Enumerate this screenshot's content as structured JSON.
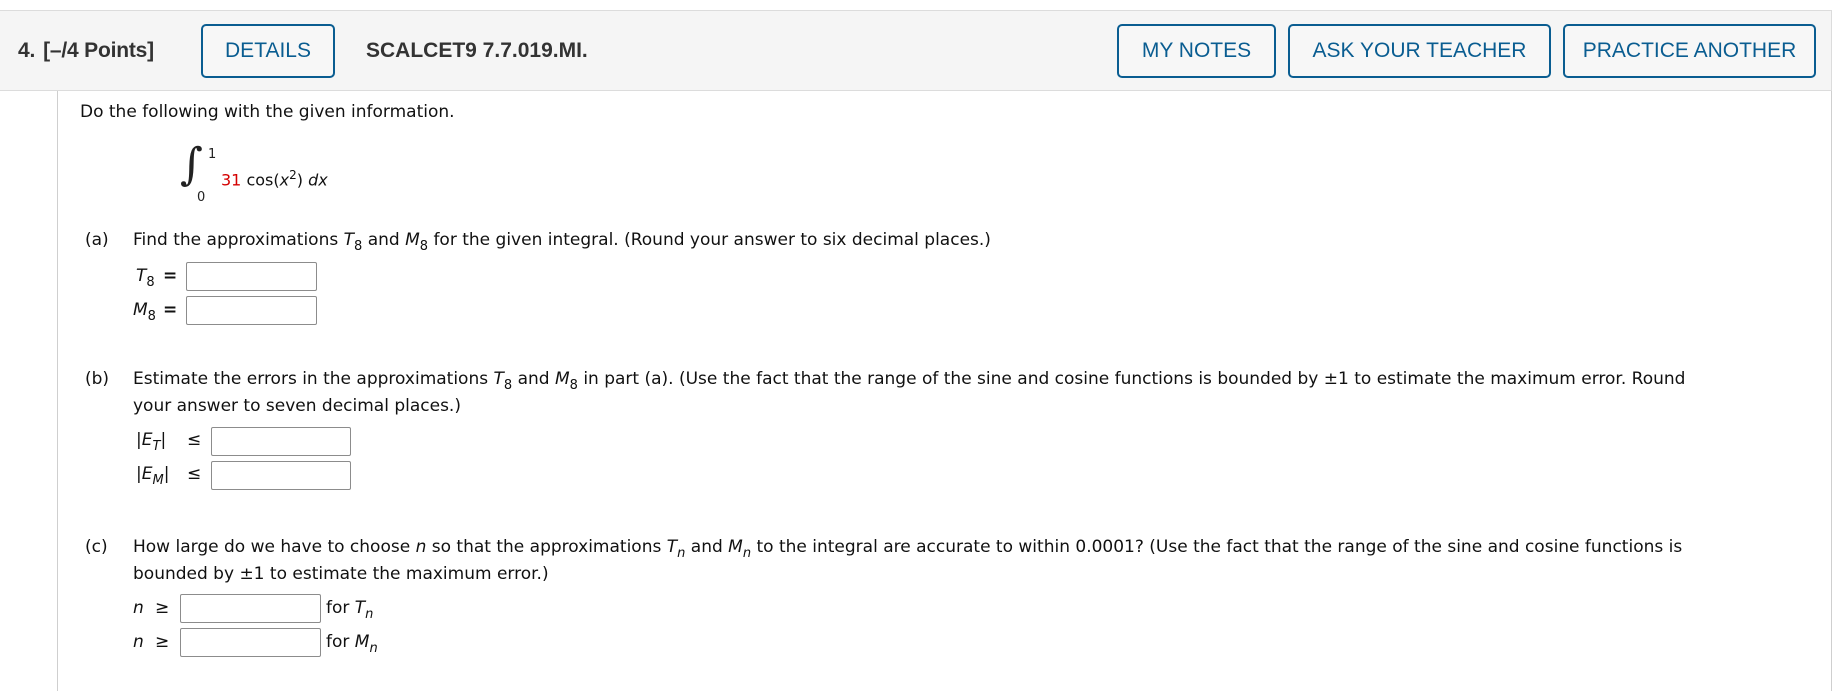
{
  "header": {
    "question_number": "4.",
    "points": "[–/4 Points]",
    "details_label": "DETAILS",
    "problem_code": "SCALCET9 7.7.019.MI.",
    "my_notes_label": "MY NOTES",
    "ask_teacher_label": "ASK YOUR TEACHER",
    "practice_another_label": "PRACTICE ANOTHER"
  },
  "colors": {
    "accent": "#0a5d91",
    "highlight_number": "#d40000",
    "header_bg": "#f5f5f5"
  },
  "intro": "Do the following with the given information.",
  "integral": {
    "upper_limit": "1",
    "lower_limit": "0",
    "coefficient": "31",
    "function": "cos(",
    "variable": "x",
    "exponent": "2",
    "close": ")",
    "differential": "dx"
  },
  "part_a": {
    "label": "(a)",
    "text_1": "Find the approximations ",
    "T": "T",
    "T_sub": "8",
    "and": " and ",
    "M": "M",
    "M_sub": "8",
    "text_2": " for the given integral. (Round your answer to six decimal places.)",
    "rows": [
      {
        "var": "T",
        "sub": "8",
        "relation": "=",
        "value": ""
      },
      {
        "var": "M",
        "sub": "8",
        "relation": "=",
        "value": ""
      }
    ]
  },
  "part_b": {
    "label": "(b)",
    "text_1": "Estimate the errors in the approximations ",
    "T": "T",
    "T_sub": "8",
    "and": " and ",
    "M": "M",
    "M_sub": "8",
    "text_2": " in part (a). (Use the fact that the range of the sine and cosine functions is bounded by ±1 to estimate the maximum error. Round",
    "line_2": "your answer to seven decimal places.)",
    "rows": [
      {
        "bar_open": "|",
        "var": "E",
        "sub": "T",
        "bar_close": "|",
        "relation": "≤",
        "value": ""
      },
      {
        "bar_open": "|",
        "var": "E",
        "sub": "M",
        "bar_close": "|",
        "relation": "≤",
        "value": ""
      }
    ]
  },
  "part_c": {
    "label": "(c)",
    "text_1": "How large do we have to choose ",
    "n": "n",
    "text_2": " so that the approximations ",
    "T": "T",
    "T_sub": "n",
    "and": " and ",
    "M": "M",
    "M_sub": "n",
    "text_3": " to the integral are accurate to within 0.0001? (Use the fact that the range of the sine and cosine functions is",
    "line_2": "bounded by ±1 to estimate the maximum error.)",
    "rows": [
      {
        "var": "n",
        "relation": "≥",
        "value": "",
        "suffix": "for ",
        "suffix_var": "T",
        "suffix_sub": "n"
      },
      {
        "var": "n",
        "relation": "≥",
        "value": "",
        "suffix": "for ",
        "suffix_var": "M",
        "suffix_sub": "n"
      }
    ]
  }
}
